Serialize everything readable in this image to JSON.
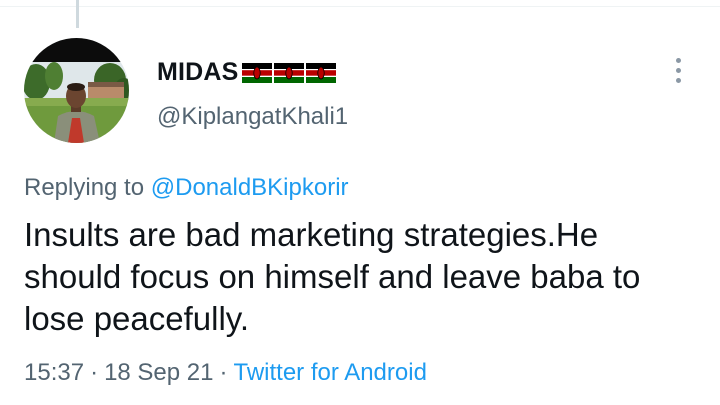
{
  "tweet": {
    "display_name": "MIDAS",
    "flag_icon": "kenya-flag-icon",
    "flag_count": 3,
    "handle": "@KiplangatKhali1",
    "replying_prefix": "Replying to",
    "replying_to": "@DonaldBKipkorir",
    "text": "Insults are bad marketing strategies.He should focus on himself and leave baba to lose peacefully.",
    "time": "15:37",
    "date": "18 Sep 21",
    "separator": "·",
    "source": "Twitter for Android"
  },
  "icons": {
    "more": "more-options-icon",
    "avatar": "user-avatar"
  },
  "colors": {
    "link": "#1d9bf0",
    "secondary_text": "#536471",
    "primary_text": "#0f1419",
    "thread_line": "#cfd9de"
  }
}
